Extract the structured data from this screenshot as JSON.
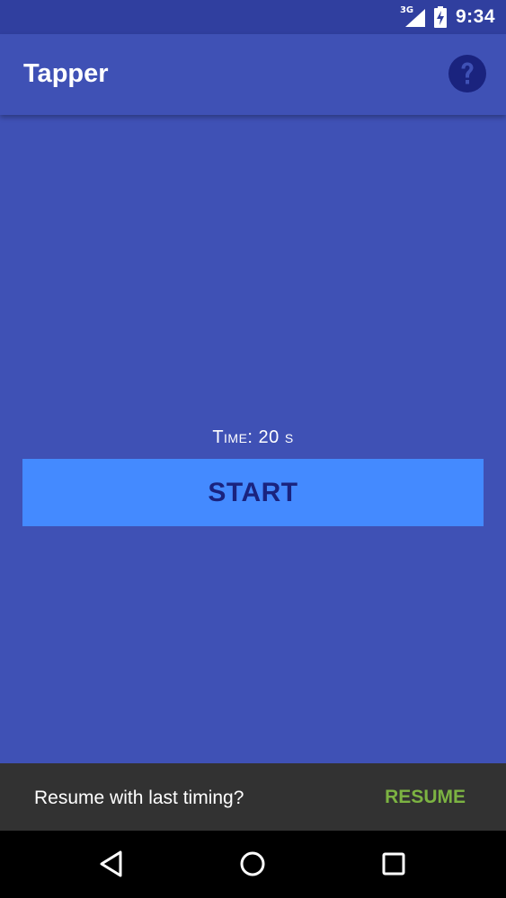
{
  "status_bar": {
    "network_type": "3G",
    "time": "9:34",
    "signal_icon": "signal-icon",
    "battery_icon": "battery-charging-icon"
  },
  "app_bar": {
    "title": "Tapper",
    "help_icon": "help-icon"
  },
  "main": {
    "time_label": "Time: 20 s",
    "start_button_label": "START"
  },
  "snackbar": {
    "message": "Resume with last timing?",
    "action_label": "RESUME"
  },
  "nav_bar": {
    "back_icon": "back-icon",
    "home_icon": "home-icon",
    "recents_icon": "recents-icon"
  },
  "colors": {
    "primary": "#3F51B5",
    "primary_dark": "#303F9F",
    "accent_button": "#448AFF",
    "snackbar_bg": "#323232",
    "snackbar_action": "#7CB342"
  }
}
